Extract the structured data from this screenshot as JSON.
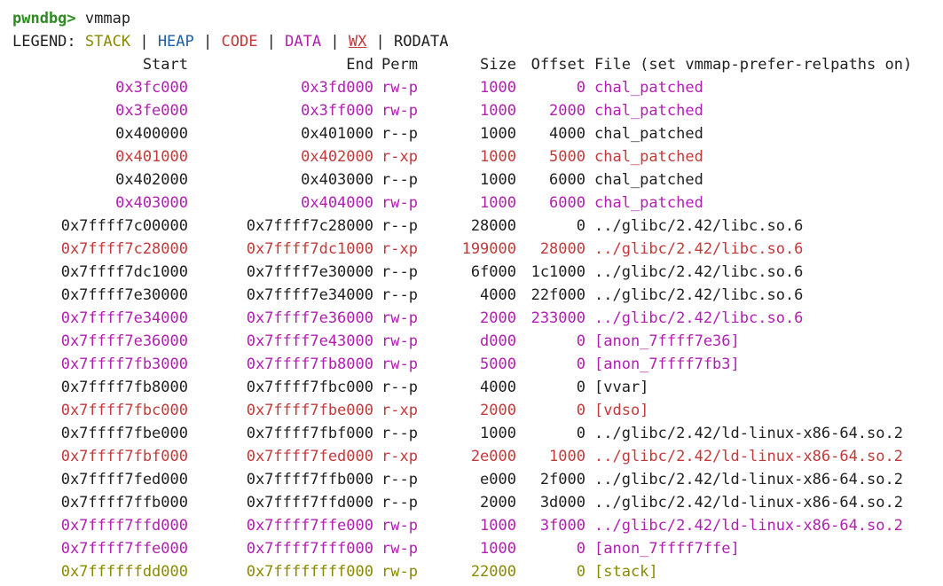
{
  "prompt": {
    "name": "pwndbg>",
    "command": "vmmap"
  },
  "legend": {
    "label": "LEGEND:",
    "items": [
      {
        "text": "STACK",
        "class": "c-stack"
      },
      {
        "text": "HEAP",
        "class": "c-heap"
      },
      {
        "text": "CODE",
        "class": "c-code"
      },
      {
        "text": "DATA",
        "class": "c-data"
      },
      {
        "text": "WX",
        "class": "c-wx"
      },
      {
        "text": "RODATA",
        "class": "c-rodata"
      }
    ]
  },
  "colors": {
    "stack": "#8a8a00",
    "heap": "#1f5fa8",
    "code": "#c23a3a",
    "data": "#b01fb0",
    "rodata": "#1f1f1f",
    "prompt": "#2e8b22"
  },
  "header": {
    "start": "Start",
    "end": "End",
    "perm": "Perm",
    "size": "Size",
    "offset": "Offset",
    "file": "File (set vmmap-prefer-relpaths on)"
  },
  "rows": [
    {
      "start": "0x3fc000",
      "end": "0x3fd000",
      "perm": "rw-p",
      "size": "1000",
      "offset": "0",
      "file": "chal_patched",
      "kind": "data"
    },
    {
      "start": "0x3fe000",
      "end": "0x3ff000",
      "perm": "rw-p",
      "size": "1000",
      "offset": "2000",
      "file": "chal_patched",
      "kind": "data"
    },
    {
      "start": "0x400000",
      "end": "0x401000",
      "perm": "r--p",
      "size": "1000",
      "offset": "4000",
      "file": "chal_patched",
      "kind": "rodata"
    },
    {
      "start": "0x401000",
      "end": "0x402000",
      "perm": "r-xp",
      "size": "1000",
      "offset": "5000",
      "file": "chal_patched",
      "kind": "code"
    },
    {
      "start": "0x402000",
      "end": "0x403000",
      "perm": "r--p",
      "size": "1000",
      "offset": "6000",
      "file": "chal_patched",
      "kind": "rodata"
    },
    {
      "start": "0x403000",
      "end": "0x404000",
      "perm": "rw-p",
      "size": "1000",
      "offset": "6000",
      "file": "chal_patched",
      "kind": "data"
    },
    {
      "start": "0x7ffff7c00000",
      "end": "0x7ffff7c28000",
      "perm": "r--p",
      "size": "28000",
      "offset": "0",
      "file": "../glibc/2.42/libc.so.6",
      "kind": "rodata"
    },
    {
      "start": "0x7ffff7c28000",
      "end": "0x7ffff7dc1000",
      "perm": "r-xp",
      "size": "199000",
      "offset": "28000",
      "file": "../glibc/2.42/libc.so.6",
      "kind": "code"
    },
    {
      "start": "0x7ffff7dc1000",
      "end": "0x7ffff7e30000",
      "perm": "r--p",
      "size": "6f000",
      "offset": "1c1000",
      "file": "../glibc/2.42/libc.so.6",
      "kind": "rodata"
    },
    {
      "start": "0x7ffff7e30000",
      "end": "0x7ffff7e34000",
      "perm": "r--p",
      "size": "4000",
      "offset": "22f000",
      "file": "../glibc/2.42/libc.so.6",
      "kind": "rodata"
    },
    {
      "start": "0x7ffff7e34000",
      "end": "0x7ffff7e36000",
      "perm": "rw-p",
      "size": "2000",
      "offset": "233000",
      "file": "../glibc/2.42/libc.so.6",
      "kind": "data"
    },
    {
      "start": "0x7ffff7e36000",
      "end": "0x7ffff7e43000",
      "perm": "rw-p",
      "size": "d000",
      "offset": "0",
      "file": "[anon_7ffff7e36]",
      "kind": "data"
    },
    {
      "start": "0x7ffff7fb3000",
      "end": "0x7ffff7fb8000",
      "perm": "rw-p",
      "size": "5000",
      "offset": "0",
      "file": "[anon_7ffff7fb3]",
      "kind": "data"
    },
    {
      "start": "0x7ffff7fb8000",
      "end": "0x7ffff7fbc000",
      "perm": "r--p",
      "size": "4000",
      "offset": "0",
      "file": "[vvar]",
      "kind": "rodata"
    },
    {
      "start": "0x7ffff7fbc000",
      "end": "0x7ffff7fbe000",
      "perm": "r-xp",
      "size": "2000",
      "offset": "0",
      "file": "[vdso]",
      "kind": "code"
    },
    {
      "start": "0x7ffff7fbe000",
      "end": "0x7ffff7fbf000",
      "perm": "r--p",
      "size": "1000",
      "offset": "0",
      "file": "../glibc/2.42/ld-linux-x86-64.so.2",
      "kind": "rodata"
    },
    {
      "start": "0x7ffff7fbf000",
      "end": "0x7ffff7fed000",
      "perm": "r-xp",
      "size": "2e000",
      "offset": "1000",
      "file": "../glibc/2.42/ld-linux-x86-64.so.2",
      "kind": "code"
    },
    {
      "start": "0x7ffff7fed000",
      "end": "0x7ffff7ffb000",
      "perm": "r--p",
      "size": "e000",
      "offset": "2f000",
      "file": "../glibc/2.42/ld-linux-x86-64.so.2",
      "kind": "rodata"
    },
    {
      "start": "0x7ffff7ffb000",
      "end": "0x7ffff7ffd000",
      "perm": "r--p",
      "size": "2000",
      "offset": "3d000",
      "file": "../glibc/2.42/ld-linux-x86-64.so.2",
      "kind": "rodata"
    },
    {
      "start": "0x7ffff7ffd000",
      "end": "0x7ffff7ffe000",
      "perm": "rw-p",
      "size": "1000",
      "offset": "3f000",
      "file": "../glibc/2.42/ld-linux-x86-64.so.2",
      "kind": "data"
    },
    {
      "start": "0x7ffff7ffe000",
      "end": "0x7ffff7fff000",
      "perm": "rw-p",
      "size": "1000",
      "offset": "0",
      "file": "[anon_7ffff7ffe]",
      "kind": "data"
    },
    {
      "start": "0x7ffffffdd000",
      "end": "0x7ffffffff000",
      "perm": "rw-p",
      "size": "22000",
      "offset": "0",
      "file": "[stack]",
      "kind": "stack"
    }
  ]
}
